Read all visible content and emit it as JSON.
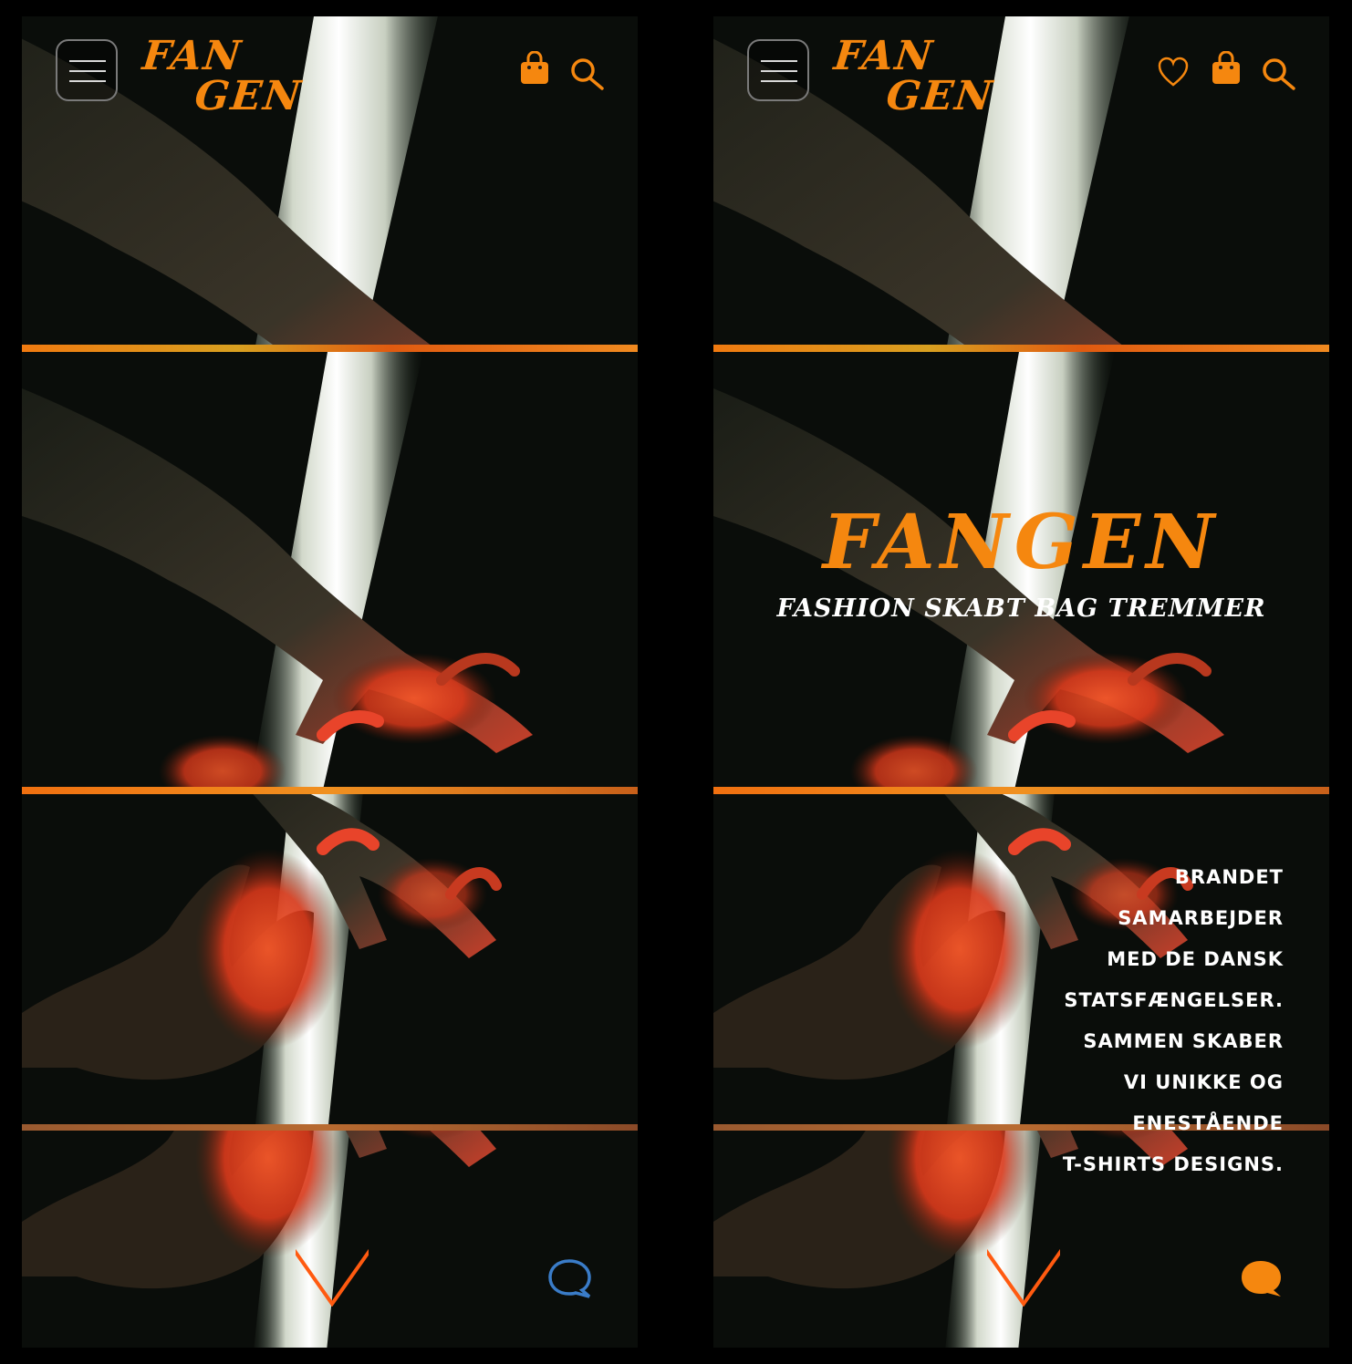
{
  "brand": {
    "logo_line1": "FAN",
    "logo_line2": "GEN",
    "accent_color": "#f5870f",
    "chat_outline_color": "#3a7cc8"
  },
  "header": {
    "menu_icon": "hamburger-icon",
    "left_icons": [
      "shopping-bag-icon",
      "search-icon"
    ],
    "right_icons": [
      "heart-icon",
      "shopping-bag-icon",
      "search-icon"
    ]
  },
  "hero": {
    "title": "FANGEN",
    "subtitle": "FASHION SKABT BAG TREMMER"
  },
  "about": {
    "lines": [
      "BRANDET",
      "SAMARBEJDER",
      "MED DE DANSK",
      "STATSFÆNGELSER.",
      "SAMMEN SKABER",
      "VI UNIKKE OG",
      "ENESTÅENDE",
      "T-SHIRTS DESIGNS."
    ]
  },
  "controls": {
    "scroll_icon": "arrow-down-icon",
    "chat_icon": "chat-bubble-icon"
  }
}
